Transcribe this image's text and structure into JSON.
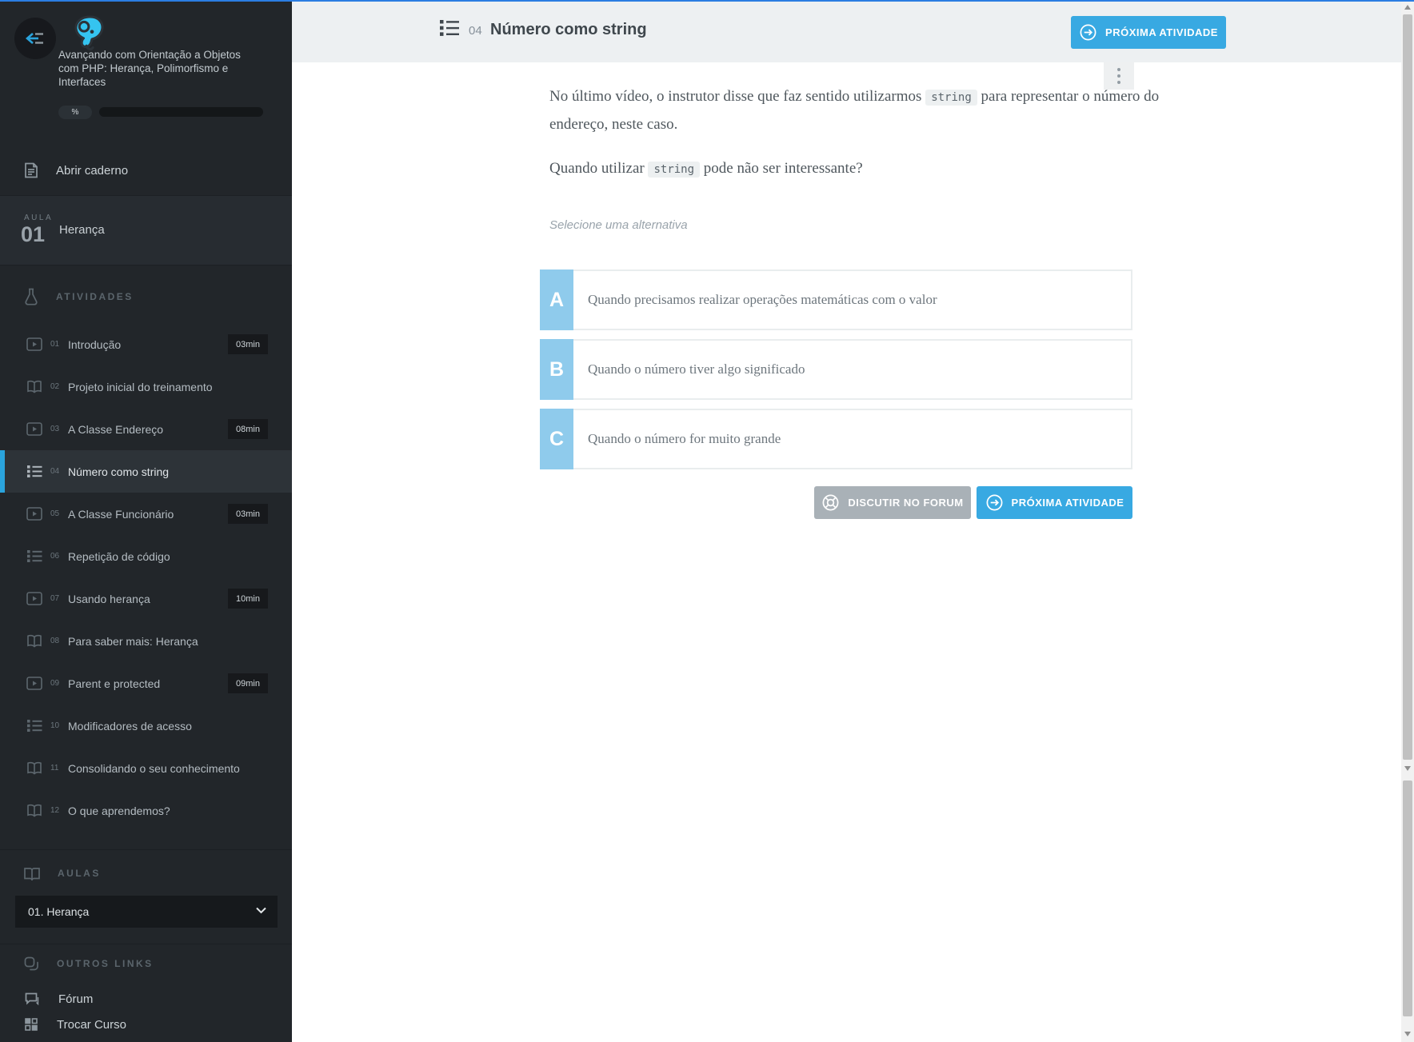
{
  "app": {
    "accent_blue": "#38a9e2",
    "topbar_blue": "#2b7de2",
    "letter_blue": "#8fcbec",
    "sidebar_bg": "#22262a"
  },
  "sidebar": {
    "course_title": "Avançando com Orientação a Objetos com PHP: Herança, Polimorfismo e Interfaces",
    "progress_label": "%",
    "notebook_label": "Abrir caderno",
    "lesson_label": "AULA",
    "lesson_number": "01",
    "lesson_title": "Herança",
    "activities_header": "ATIVIDADES",
    "activities": [
      {
        "num": "01",
        "title": "Introdução",
        "type": "video",
        "duration": "03min",
        "active": false
      },
      {
        "num": "02",
        "title": "Projeto inicial do treinamento",
        "type": "reading",
        "duration": "",
        "active": false
      },
      {
        "num": "03",
        "title": "A Classe Endereço",
        "type": "video",
        "duration": "08min",
        "active": false
      },
      {
        "num": "04",
        "title": "Número como string",
        "type": "quiz",
        "duration": "",
        "active": true
      },
      {
        "num": "05",
        "title": "A Classe Funcionário",
        "type": "video",
        "duration": "03min",
        "active": false
      },
      {
        "num": "06",
        "title": "Repetição de código",
        "type": "quiz",
        "duration": "",
        "active": false
      },
      {
        "num": "07",
        "title": "Usando herança",
        "type": "video",
        "duration": "10min",
        "active": false
      },
      {
        "num": "08",
        "title": "Para saber mais: Herança",
        "type": "reading",
        "duration": "",
        "active": false
      },
      {
        "num": "09",
        "title": "Parent e protected",
        "type": "video",
        "duration": "09min",
        "active": false
      },
      {
        "num": "10",
        "title": "Modificadores de acesso",
        "type": "quiz",
        "duration": "",
        "active": false
      },
      {
        "num": "11",
        "title": "Consolidando o seu conhecimento",
        "type": "reading",
        "duration": "",
        "active": false
      },
      {
        "num": "12",
        "title": "O que aprendemos?",
        "type": "reading",
        "duration": "",
        "active": false
      }
    ],
    "aulas_header": "AULAS",
    "aula_select": "01. Herança",
    "other_links_header": "OUTROS LINKS",
    "links": [
      {
        "label": "Fórum"
      },
      {
        "label": "Trocar Curso"
      }
    ]
  },
  "header": {
    "activity_number": "04",
    "title": "Número como string",
    "next_button": "PRÓXIMA ATIVIDADE"
  },
  "question": {
    "p1_before": "No último vídeo, o instrutor disse que faz sentido utilizarmos",
    "p1_code": "string",
    "p1_after": "para representar o número do endereço, neste caso.",
    "p2_before": "Quando utilizar",
    "p2_code": "string",
    "p2_after": "pode não ser interessante?",
    "hint": "Selecione uma alternativa",
    "options": [
      {
        "letter": "A",
        "text": "Quando precisamos realizar operações matemáticas com o valor"
      },
      {
        "letter": "B",
        "text": "Quando o número tiver algo significado"
      },
      {
        "letter": "C",
        "text": "Quando o número for muito grande"
      }
    ],
    "discuss_button": "DISCUTIR NO FORUM",
    "next_button": "PRÓXIMA ATIVIDADE"
  }
}
